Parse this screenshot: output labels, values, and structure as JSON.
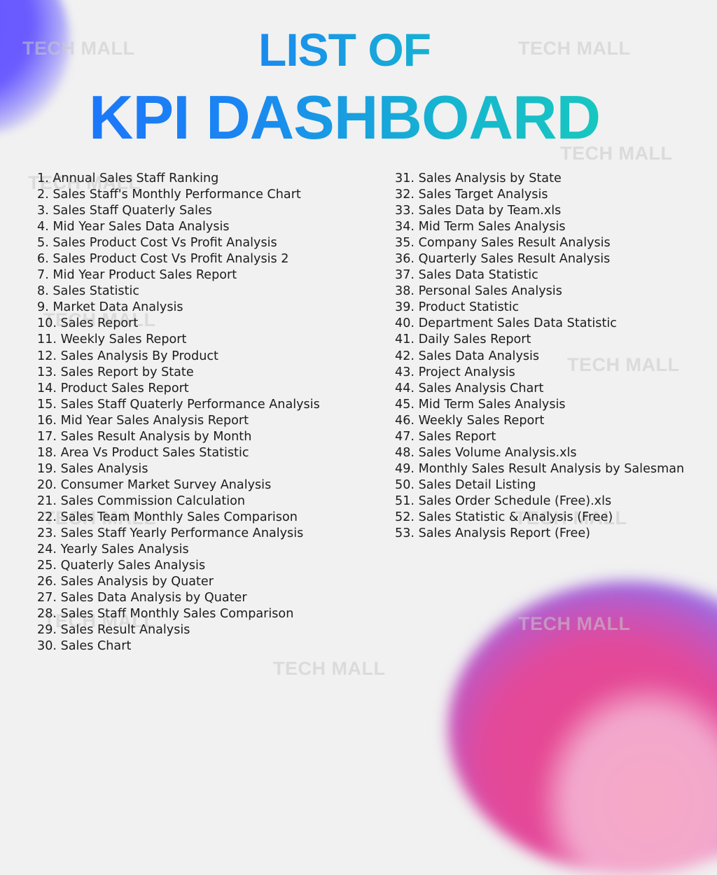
{
  "title": {
    "line1": "LIST OF",
    "line2": "KPI DASHBOARD"
  },
  "watermark_text": "TECH MALL",
  "colors": {
    "title_gradient_start": "#1e6fff",
    "title_gradient_end": "#19d1b6",
    "background": "#f1f1f1",
    "blob_top_left": "#6658ff",
    "blob_bottom_right_pink": "#e8478c",
    "blob_bottom_right_purple": "#9d6be0"
  },
  "list_left": [
    "1. Annual Sales Staff Ranking",
    "2. Sales Staff's Monthly Performance Chart",
    "3. Sales Staff Quaterly Sales",
    "4. Mid Year Sales Data Analysis",
    "5. Sales Product Cost Vs Profit Analysis",
    "6. Sales Product Cost Vs Profit Analysis 2",
    "7. Mid Year Product Sales Report",
    "8. Sales Statistic",
    "9. Market Data Analysis",
    "10. Sales Report",
    "11. Weekly Sales Report",
    "12. Sales Analysis By Product",
    "13. Sales Report by State",
    "14. Product Sales Report",
    "15. Sales Staff Quaterly Performance Analysis",
    "16. Mid Year Sales Analysis Report",
    "17. Sales Result Analysis by Month",
    "18. Area Vs Product Sales Statistic",
    "19. Sales Analysis",
    "20. Consumer Market Survey Analysis",
    "21. Sales Commission Calculation",
    "22. Sales Team Monthly Sales Comparison",
    "23. Sales Staff Yearly Performance  Analysis",
    "24. Yearly Sales Analysis",
    "25. Quaterly Sales Analysis",
    "26. Sales Analysis by Quater",
    "27. Sales Data Analysis by Quater",
    "28. Sales Staff Monthly Sales Comparison",
    "29. Sales Result Analysis",
    "30. Sales Chart"
  ],
  "list_right": [
    "31. Sales Analysis by State",
    "32. Sales Target Analysis",
    "33. Sales Data by Team.xls",
    "34. Mid Term Sales Analysis",
    "35. Company Sales Result Analysis",
    "36. Quarterly Sales Result Analysis",
    "37. Sales Data Statistic",
    "38. Personal Sales Analysis",
    "39. Product Statistic",
    "40. Department Sales Data Statistic",
    "41. Daily Sales Report",
    "42. Sales Data Analysis",
    "43. Project Analysis",
    "44. Sales Analysis Chart",
    "45. Mid Term Sales Analysis",
    "46. Weekly Sales Report",
    "47. Sales Report",
    "48. Sales Volume Analysis.xls",
    "49. Monthly Sales Result Analysis by Salesman",
    "50. Sales Detail Listing",
    "51. Sales Order Schedule (Free).xls",
    "52. Sales Statistic & Analysis (Free)",
    "53. Sales Analysis Report (Free)"
  ]
}
